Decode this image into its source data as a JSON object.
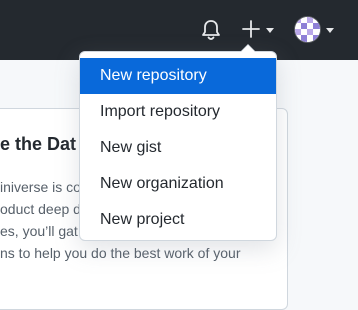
{
  "header": {
    "icons": [
      "bell-icon",
      "plus-icon",
      "chevron-down-icon",
      "avatar"
    ]
  },
  "menu": {
    "items": [
      {
        "label": "New repository"
      },
      {
        "label": "Import repository"
      },
      {
        "label": "New gist"
      },
      {
        "label": "New organization"
      },
      {
        "label": "New project"
      }
    ]
  },
  "background": {
    "title_fragment": "e the Dat",
    "lines": [
      "iniverse is cor",
      "oduct deep di",
      "es, you’ll gat",
      "ns to help you do the best work of your"
    ]
  },
  "colors": {
    "header_bg": "#24292f",
    "active_item_bg": "#0969da",
    "menu_border": "#d0d7de"
  }
}
